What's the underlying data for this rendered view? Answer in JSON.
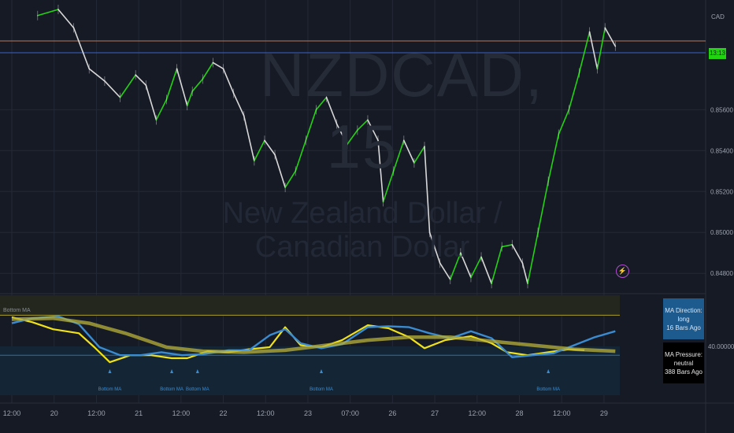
{
  "chart_data": {
    "type": "line",
    "symbol_watermark": "NZDCAD, 15",
    "description_watermark": "New Zealand Dollar / Canadian Dollar",
    "currency": "CAD",
    "price_axis": {
      "ticks": [
        "0.85600",
        "0.85400",
        "0.85200",
        "0.85000",
        "0.84800"
      ],
      "ylim": [
        0.8472,
        0.8609
      ],
      "current_price_tag": "13:13"
    },
    "time_axis": {
      "ticks": [
        "12:00",
        "20",
        "12:00",
        "21",
        "12:00",
        "22",
        "12:00",
        "23",
        "07:00",
        "26",
        "27",
        "12:00",
        "28",
        "12:00",
        "29"
      ]
    },
    "price_series": [
      {
        "t": 0.5,
        "y": 0.8606
      },
      {
        "t": 0.9,
        "y": 0.8609
      },
      {
        "t": 1.2,
        "y": 0.86
      },
      {
        "t": 1.5,
        "y": 0.858
      },
      {
        "t": 1.8,
        "y": 0.8574
      },
      {
        "t": 2.1,
        "y": 0.8566
      },
      {
        "t": 2.4,
        "y": 0.8577
      },
      {
        "t": 2.6,
        "y": 0.8572
      },
      {
        "t": 2.8,
        "y": 0.8555
      },
      {
        "t": 3.0,
        "y": 0.8565
      },
      {
        "t": 3.2,
        "y": 0.858
      },
      {
        "t": 3.4,
        "y": 0.8562
      },
      {
        "t": 3.5,
        "y": 0.8569
      },
      {
        "t": 3.7,
        "y": 0.8575
      },
      {
        "t": 3.9,
        "y": 0.8583
      },
      {
        "t": 4.1,
        "y": 0.858
      },
      {
        "t": 4.3,
        "y": 0.8568
      },
      {
        "t": 4.5,
        "y": 0.8557
      },
      {
        "t": 4.7,
        "y": 0.8535
      },
      {
        "t": 4.9,
        "y": 0.8545
      },
      {
        "t": 5.1,
        "y": 0.8538
      },
      {
        "t": 5.3,
        "y": 0.8522
      },
      {
        "t": 5.5,
        "y": 0.853
      },
      {
        "t": 5.7,
        "y": 0.8545
      },
      {
        "t": 5.9,
        "y": 0.856
      },
      {
        "t": 6.1,
        "y": 0.8566
      },
      {
        "t": 6.3,
        "y": 0.8553
      },
      {
        "t": 6.5,
        "y": 0.8543
      },
      {
        "t": 6.7,
        "y": 0.855
      },
      {
        "t": 6.9,
        "y": 0.8555
      },
      {
        "t": 7.1,
        "y": 0.8545
      },
      {
        "t": 7.2,
        "y": 0.8515
      },
      {
        "t": 7.4,
        "y": 0.853
      },
      {
        "t": 7.6,
        "y": 0.8545
      },
      {
        "t": 7.8,
        "y": 0.8534
      },
      {
        "t": 8.0,
        "y": 0.8542
      },
      {
        "t": 8.1,
        "y": 0.85
      },
      {
        "t": 8.3,
        "y": 0.8485
      },
      {
        "t": 8.5,
        "y": 0.8477
      },
      {
        "t": 8.7,
        "y": 0.849
      },
      {
        "t": 8.9,
        "y": 0.8478
      },
      {
        "t": 9.1,
        "y": 0.8488
      },
      {
        "t": 9.3,
        "y": 0.8475
      },
      {
        "t": 9.5,
        "y": 0.8493
      },
      {
        "t": 9.7,
        "y": 0.8494
      },
      {
        "t": 9.9,
        "y": 0.8485
      },
      {
        "t": 10.0,
        "y": 0.8475
      },
      {
        "t": 10.2,
        "y": 0.85
      },
      {
        "t": 10.4,
        "y": 0.8525
      },
      {
        "t": 10.6,
        "y": 0.8548
      },
      {
        "t": 10.8,
        "y": 0.856
      },
      {
        "t": 11.0,
        "y": 0.8578
      },
      {
        "t": 11.2,
        "y": 0.8598
      },
      {
        "t": 11.35,
        "y": 0.858
      },
      {
        "t": 11.5,
        "y": 0.86
      },
      {
        "t": 11.7,
        "y": 0.8591
      }
    ],
    "indicator": {
      "title": "Bottom MA",
      "value_label": "40.00000",
      "ylim": [
        0,
        100
      ],
      "reference_lines": [
        80,
        40
      ],
      "series": [
        {
          "color": "#f0e21a",
          "values": [
            {
              "t": 0,
              "y": 78
            },
            {
              "t": 0.4,
              "y": 73
            },
            {
              "t": 0.8,
              "y": 66
            },
            {
              "t": 1.3,
              "y": 62
            },
            {
              "t": 1.6,
              "y": 48
            },
            {
              "t": 1.9,
              "y": 33
            },
            {
              "t": 2.3,
              "y": 40
            },
            {
              "t": 2.7,
              "y": 40
            },
            {
              "t": 3.1,
              "y": 37
            },
            {
              "t": 3.4,
              "y": 37
            },
            {
              "t": 3.8,
              "y": 44
            },
            {
              "t": 4.2,
              "y": 43
            },
            {
              "t": 4.6,
              "y": 46
            },
            {
              "t": 5.0,
              "y": 48
            },
            {
              "t": 5.3,
              "y": 68
            },
            {
              "t": 5.6,
              "y": 50
            },
            {
              "t": 6.0,
              "y": 48
            },
            {
              "t": 6.4,
              "y": 55
            },
            {
              "t": 6.9,
              "y": 70
            },
            {
              "t": 7.3,
              "y": 67
            },
            {
              "t": 7.7,
              "y": 58
            },
            {
              "t": 8.0,
              "y": 47
            },
            {
              "t": 8.4,
              "y": 55
            },
            {
              "t": 8.9,
              "y": 59
            },
            {
              "t": 9.3,
              "y": 52
            },
            {
              "t": 9.6,
              "y": 43
            },
            {
              "t": 10.0,
              "y": 40
            },
            {
              "t": 10.4,
              "y": 43
            },
            {
              "t": 10.8,
              "y": 46
            },
            {
              "t": 11.1,
              "y": 45
            }
          ]
        },
        {
          "color": "#3b8bd0",
          "values": [
            {
              "t": 0,
              "y": 72
            },
            {
              "t": 0.4,
              "y": 77
            },
            {
              "t": 0.9,
              "y": 79
            },
            {
              "t": 1.3,
              "y": 71
            },
            {
              "t": 1.7,
              "y": 48
            },
            {
              "t": 2.1,
              "y": 40
            },
            {
              "t": 2.5,
              "y": 40
            },
            {
              "t": 2.9,
              "y": 43
            },
            {
              "t": 3.3,
              "y": 40
            },
            {
              "t": 3.7,
              "y": 41
            },
            {
              "t": 4.2,
              "y": 45
            },
            {
              "t": 4.6,
              "y": 45
            },
            {
              "t": 5.0,
              "y": 60
            },
            {
              "t": 5.3,
              "y": 66
            },
            {
              "t": 5.6,
              "y": 52
            },
            {
              "t": 6.0,
              "y": 47
            },
            {
              "t": 6.4,
              "y": 51
            },
            {
              "t": 6.9,
              "y": 68
            },
            {
              "t": 7.3,
              "y": 69
            },
            {
              "t": 7.7,
              "y": 68
            },
            {
              "t": 8.1,
              "y": 62
            },
            {
              "t": 8.5,
              "y": 57
            },
            {
              "t": 8.9,
              "y": 64
            },
            {
              "t": 9.3,
              "y": 57
            },
            {
              "t": 9.7,
              "y": 38
            },
            {
              "t": 10.1,
              "y": 40
            },
            {
              "t": 10.5,
              "y": 42
            },
            {
              "t": 10.9,
              "y": 50
            },
            {
              "t": 11.3,
              "y": 58
            },
            {
              "t": 11.7,
              "y": 64
            }
          ]
        },
        {
          "color": "#b8b03a",
          "values": [
            {
              "t": 0,
              "y": 76
            },
            {
              "t": 0.8,
              "y": 77
            },
            {
              "t": 1.5,
              "y": 72
            },
            {
              "t": 2.2,
              "y": 62
            },
            {
              "t": 3.0,
              "y": 48
            },
            {
              "t": 3.7,
              "y": 44
            },
            {
              "t": 4.5,
              "y": 43
            },
            {
              "t": 5.3,
              "y": 45
            },
            {
              "t": 6.1,
              "y": 50
            },
            {
              "t": 6.9,
              "y": 55
            },
            {
              "t": 7.7,
              "y": 58
            },
            {
              "t": 8.5,
              "y": 58
            },
            {
              "t": 9.3,
              "y": 54
            },
            {
              "t": 10.1,
              "y": 50
            },
            {
              "t": 10.9,
              "y": 46
            },
            {
              "t": 11.7,
              "y": 44
            }
          ]
        }
      ],
      "signal_labels": [
        {
          "t": 1.9,
          "text": "Bottom MA"
        },
        {
          "t": 3.1,
          "text": "Bottom MA"
        },
        {
          "t": 3.6,
          "text": "Bottom MA"
        },
        {
          "t": 6.0,
          "text": "Bottom MA"
        },
        {
          "t": 10.4,
          "text": "Bottom MA"
        }
      ]
    },
    "info_boxes": {
      "direction": [
        "MA Direction: long",
        "16 Bars Ago"
      ],
      "pressure": [
        "MA Pressure: neutral",
        "388 Bars Ago"
      ]
    },
    "colors": {
      "up": "#22d312",
      "down": "#d8d8d8",
      "background": "#161a25",
      "grid": "#242936"
    },
    "grid": true
  }
}
